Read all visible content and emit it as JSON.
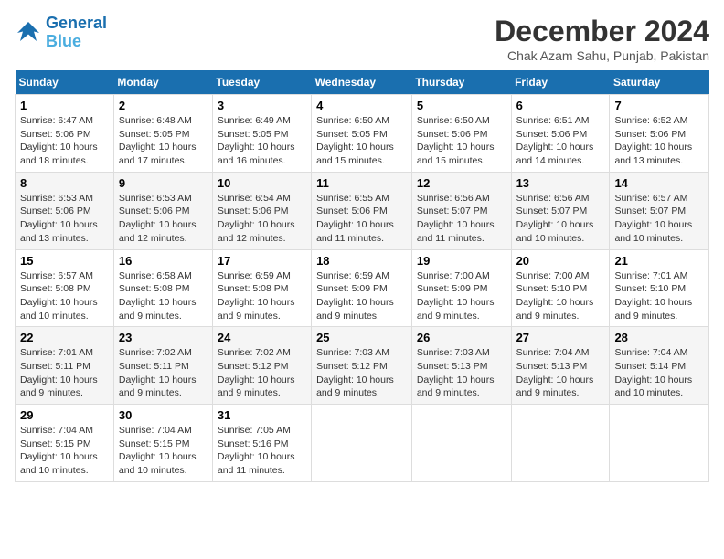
{
  "logo": {
    "line1": "General",
    "line2": "Blue"
  },
  "title": "December 2024",
  "location": "Chak Azam Sahu, Punjab, Pakistan",
  "days_of_week": [
    "Sunday",
    "Monday",
    "Tuesday",
    "Wednesday",
    "Thursday",
    "Friday",
    "Saturday"
  ],
  "weeks": [
    [
      {
        "day": "1",
        "sunrise": "Sunrise: 6:47 AM",
        "sunset": "Sunset: 5:06 PM",
        "daylight": "Daylight: 10 hours and 18 minutes."
      },
      {
        "day": "2",
        "sunrise": "Sunrise: 6:48 AM",
        "sunset": "Sunset: 5:05 PM",
        "daylight": "Daylight: 10 hours and 17 minutes."
      },
      {
        "day": "3",
        "sunrise": "Sunrise: 6:49 AM",
        "sunset": "Sunset: 5:05 PM",
        "daylight": "Daylight: 10 hours and 16 minutes."
      },
      {
        "day": "4",
        "sunrise": "Sunrise: 6:50 AM",
        "sunset": "Sunset: 5:05 PM",
        "daylight": "Daylight: 10 hours and 15 minutes."
      },
      {
        "day": "5",
        "sunrise": "Sunrise: 6:50 AM",
        "sunset": "Sunset: 5:06 PM",
        "daylight": "Daylight: 10 hours and 15 minutes."
      },
      {
        "day": "6",
        "sunrise": "Sunrise: 6:51 AM",
        "sunset": "Sunset: 5:06 PM",
        "daylight": "Daylight: 10 hours and 14 minutes."
      },
      {
        "day": "7",
        "sunrise": "Sunrise: 6:52 AM",
        "sunset": "Sunset: 5:06 PM",
        "daylight": "Daylight: 10 hours and 13 minutes."
      }
    ],
    [
      {
        "day": "8",
        "sunrise": "Sunrise: 6:53 AM",
        "sunset": "Sunset: 5:06 PM",
        "daylight": "Daylight: 10 hours and 13 minutes."
      },
      {
        "day": "9",
        "sunrise": "Sunrise: 6:53 AM",
        "sunset": "Sunset: 5:06 PM",
        "daylight": "Daylight: 10 hours and 12 minutes."
      },
      {
        "day": "10",
        "sunrise": "Sunrise: 6:54 AM",
        "sunset": "Sunset: 5:06 PM",
        "daylight": "Daylight: 10 hours and 12 minutes."
      },
      {
        "day": "11",
        "sunrise": "Sunrise: 6:55 AM",
        "sunset": "Sunset: 5:06 PM",
        "daylight": "Daylight: 10 hours and 11 minutes."
      },
      {
        "day": "12",
        "sunrise": "Sunrise: 6:56 AM",
        "sunset": "Sunset: 5:07 PM",
        "daylight": "Daylight: 10 hours and 11 minutes."
      },
      {
        "day": "13",
        "sunrise": "Sunrise: 6:56 AM",
        "sunset": "Sunset: 5:07 PM",
        "daylight": "Daylight: 10 hours and 10 minutes."
      },
      {
        "day": "14",
        "sunrise": "Sunrise: 6:57 AM",
        "sunset": "Sunset: 5:07 PM",
        "daylight": "Daylight: 10 hours and 10 minutes."
      }
    ],
    [
      {
        "day": "15",
        "sunrise": "Sunrise: 6:57 AM",
        "sunset": "Sunset: 5:08 PM",
        "daylight": "Daylight: 10 hours and 10 minutes."
      },
      {
        "day": "16",
        "sunrise": "Sunrise: 6:58 AM",
        "sunset": "Sunset: 5:08 PM",
        "daylight": "Daylight: 10 hours and 9 minutes."
      },
      {
        "day": "17",
        "sunrise": "Sunrise: 6:59 AM",
        "sunset": "Sunset: 5:08 PM",
        "daylight": "Daylight: 10 hours and 9 minutes."
      },
      {
        "day": "18",
        "sunrise": "Sunrise: 6:59 AM",
        "sunset": "Sunset: 5:09 PM",
        "daylight": "Daylight: 10 hours and 9 minutes."
      },
      {
        "day": "19",
        "sunrise": "Sunrise: 7:00 AM",
        "sunset": "Sunset: 5:09 PM",
        "daylight": "Daylight: 10 hours and 9 minutes."
      },
      {
        "day": "20",
        "sunrise": "Sunrise: 7:00 AM",
        "sunset": "Sunset: 5:10 PM",
        "daylight": "Daylight: 10 hours and 9 minutes."
      },
      {
        "day": "21",
        "sunrise": "Sunrise: 7:01 AM",
        "sunset": "Sunset: 5:10 PM",
        "daylight": "Daylight: 10 hours and 9 minutes."
      }
    ],
    [
      {
        "day": "22",
        "sunrise": "Sunrise: 7:01 AM",
        "sunset": "Sunset: 5:11 PM",
        "daylight": "Daylight: 10 hours and 9 minutes."
      },
      {
        "day": "23",
        "sunrise": "Sunrise: 7:02 AM",
        "sunset": "Sunset: 5:11 PM",
        "daylight": "Daylight: 10 hours and 9 minutes."
      },
      {
        "day": "24",
        "sunrise": "Sunrise: 7:02 AM",
        "sunset": "Sunset: 5:12 PM",
        "daylight": "Daylight: 10 hours and 9 minutes."
      },
      {
        "day": "25",
        "sunrise": "Sunrise: 7:03 AM",
        "sunset": "Sunset: 5:12 PM",
        "daylight": "Daylight: 10 hours and 9 minutes."
      },
      {
        "day": "26",
        "sunrise": "Sunrise: 7:03 AM",
        "sunset": "Sunset: 5:13 PM",
        "daylight": "Daylight: 10 hours and 9 minutes."
      },
      {
        "day": "27",
        "sunrise": "Sunrise: 7:04 AM",
        "sunset": "Sunset: 5:13 PM",
        "daylight": "Daylight: 10 hours and 9 minutes."
      },
      {
        "day": "28",
        "sunrise": "Sunrise: 7:04 AM",
        "sunset": "Sunset: 5:14 PM",
        "daylight": "Daylight: 10 hours and 10 minutes."
      }
    ],
    [
      {
        "day": "29",
        "sunrise": "Sunrise: 7:04 AM",
        "sunset": "Sunset: 5:15 PM",
        "daylight": "Daylight: 10 hours and 10 minutes."
      },
      {
        "day": "30",
        "sunrise": "Sunrise: 7:04 AM",
        "sunset": "Sunset: 5:15 PM",
        "daylight": "Daylight: 10 hours and 10 minutes."
      },
      {
        "day": "31",
        "sunrise": "Sunrise: 7:05 AM",
        "sunset": "Sunset: 5:16 PM",
        "daylight": "Daylight: 10 hours and 11 minutes."
      },
      null,
      null,
      null,
      null
    ]
  ]
}
